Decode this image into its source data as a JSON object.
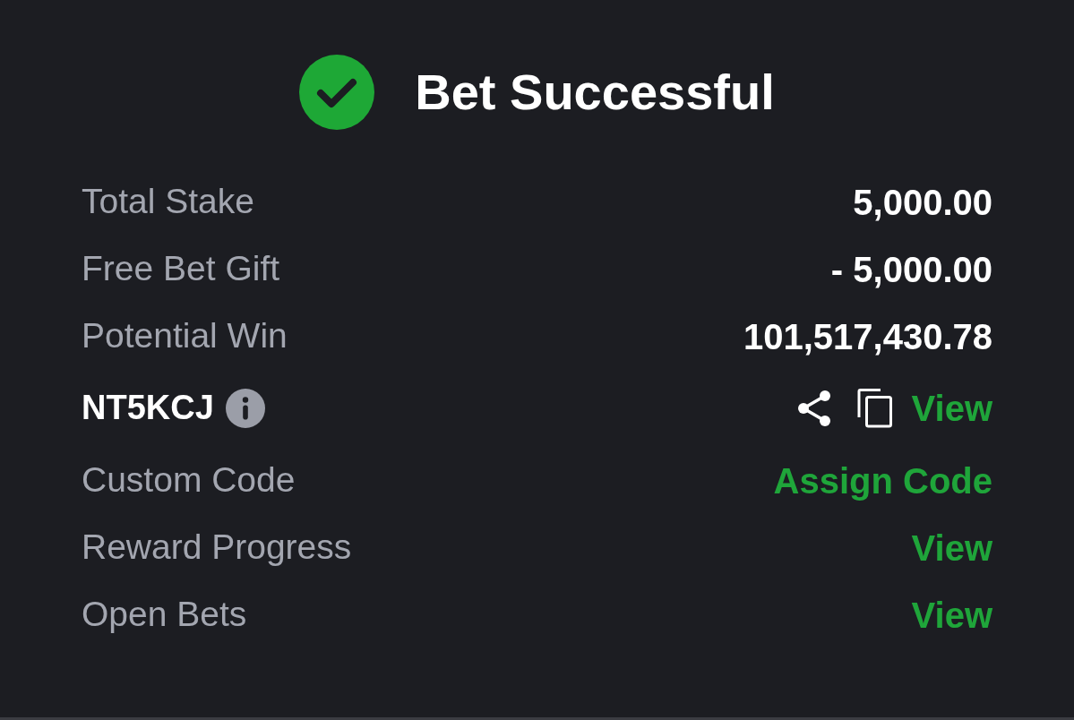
{
  "header": {
    "title": "Bet Successful"
  },
  "rows": [
    {
      "kind": "amount",
      "label": "Total Stake",
      "value": "5,000.00"
    },
    {
      "kind": "amount",
      "label": "Free Bet Gift",
      "value": "- 5,000.00"
    },
    {
      "kind": "amount",
      "label": "Potential Win",
      "value": "101,517,430.78"
    },
    {
      "kind": "code",
      "label": "NT5KCJ",
      "link": "View"
    },
    {
      "kind": "link",
      "label": "Custom Code",
      "link": "Assign Code"
    },
    {
      "kind": "link",
      "label": "Reward Progress",
      "link": "View"
    },
    {
      "kind": "link",
      "label": "Open Bets",
      "link": "View"
    }
  ]
}
